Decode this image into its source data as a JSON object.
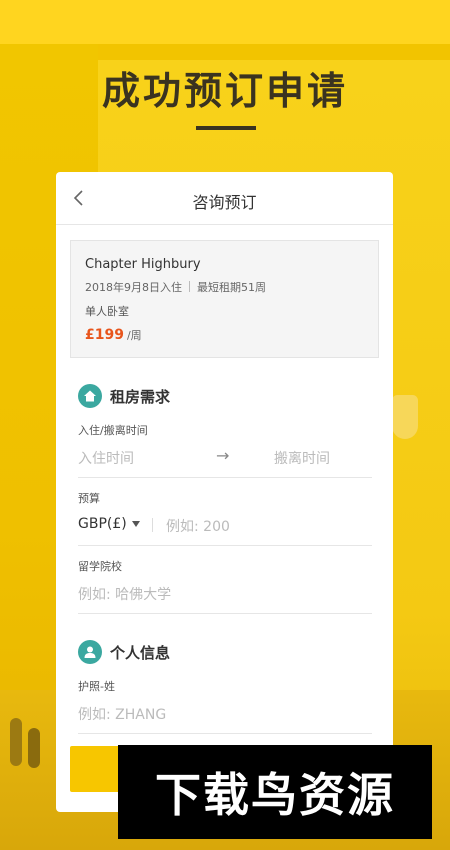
{
  "headline": "成功预订申请",
  "card": {
    "title": "咨询预订",
    "listing": {
      "name": "Chapter Highbury",
      "move_in": "2018年9月8日入住",
      "min_lease": "最短租期51周",
      "room_type": "单人卧室",
      "price": "£199",
      "price_unit": "/周"
    },
    "rental": {
      "section_title": "租房需求",
      "date_label": "入住/搬离时间",
      "move_in_placeholder": "入住时间",
      "move_out_placeholder": "搬离时间",
      "budget_label": "预算",
      "currency": "GBP(£)",
      "budget_placeholder": "例如: 200",
      "school_label": "留学院校",
      "school_placeholder": "例如: 哈佛大学"
    },
    "personal": {
      "section_title": "个人信息",
      "surname_label": "护照-姓",
      "surname_placeholder": "例如: ZHANG"
    }
  },
  "watermark": "下载鸟资源",
  "colors": {
    "accent_yellow": "#f7c600",
    "price_orange": "#e8551c",
    "icon_teal": "#3ba8a0"
  }
}
